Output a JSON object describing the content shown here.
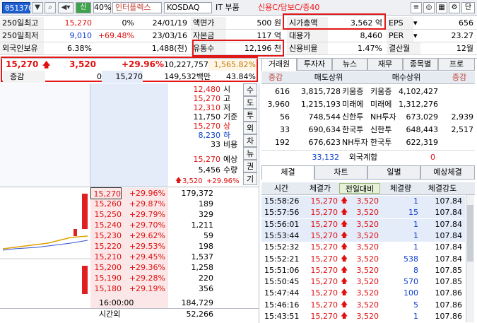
{
  "toolbar": {
    "code": "051370",
    "pct": "40%",
    "name": "인터플렉스",
    "market": "KOSDAQ",
    "sector": "IT 부품",
    "credit": "신용C/담보C/증40",
    "btn_single": "단",
    "btn_sin": "신"
  },
  "info": {
    "high250_label": "250일최고",
    "high250_val": "15,270",
    "high250_pct": "0%",
    "high250_date": "24/01/19",
    "par_label": "액면가",
    "par_val": "500 원",
    "cap_label": "시가총액",
    "cap_val": "3,562 억",
    "eps_label": "EPS",
    "eps_val": "656",
    "low250_label": "250일최저",
    "low250_val": "9,010",
    "low250_pct": "+69.48%",
    "low250_date": "23/03/16",
    "capital_label": "자본금",
    "capital_val": "117 억",
    "lending_label": "대용가",
    "lending_val": "8,460",
    "per_label": "PER",
    "per_val": "23.27",
    "foreign_label": "외국인보유",
    "foreign_pct": "6.38%",
    "foreign_qty": "1,488(천)",
    "float_label": "유통수",
    "float_val": "12,196 천",
    "credit_label": "신용비율",
    "credit_val": "1.47%",
    "settle_label": "결산월",
    "settle_val": "12월"
  },
  "price": {
    "current": "15,270",
    "change": "3,520",
    "change_pct": "+29.96%",
    "volume": "10,227,757",
    "volume_pct": "1,565.82%",
    "row2_label": "증감",
    "row2_a": "0",
    "row2_b": "15,270",
    "row2_c": "149,532백만",
    "row2_d": "43.84%"
  },
  "tabs_top": [
    "거래원",
    "투자자",
    "뉴스",
    "재무",
    "종목별",
    "프로"
  ],
  "broker": {
    "headers": [
      "증감",
      "매도상위",
      "매수상위",
      "증감"
    ],
    "rows": [
      {
        "c1": "616",
        "c2": "3,815,728",
        "c3": "키움증",
        "c4": "키움증",
        "c5": "4,102,427",
        "c6": ""
      },
      {
        "c1": "3,960",
        "c2": "1,215,193",
        "c3": "미래에",
        "c4": "미래에",
        "c5": "1,312,276",
        "c6": ""
      },
      {
        "c1": "56",
        "c2": "748,544",
        "c3": "신한투",
        "c4": "NH투자",
        "c5": "673,029",
        "c6": "2,939"
      },
      {
        "c1": "33",
        "c2": "690,634",
        "c3": "한국투",
        "c4": "신한투",
        "c5": "648,443",
        "c6": "2,517"
      },
      {
        "c1": "192",
        "c2": "676,623",
        "c3": "NH투자",
        "c4": "한국투",
        "c5": "622,319",
        "c6": ""
      }
    ],
    "foreign_sum_left": "33,132",
    "foreign_sum_label": "외국계합",
    "foreign_sum_right": "0"
  },
  "tabs_mid": [
    "체결",
    "차트",
    "일별",
    "예상체결"
  ],
  "trades": {
    "headers": [
      "시간",
      "체결가",
      "전일대비",
      "체결량",
      "체결강도"
    ],
    "rows": [
      {
        "t": "15:58:26",
        "p": "15,270",
        "d": "3,520",
        "q": "1",
        "s": "107.84"
      },
      {
        "t": "15:57:56",
        "p": "15,270",
        "d": "3,520",
        "q": "15",
        "s": "107.84"
      },
      {
        "t": "15:56:01",
        "p": "15,270",
        "d": "3,520",
        "q": "1",
        "s": "107.84"
      },
      {
        "t": "15:53:44",
        "p": "15,270",
        "d": "3,520",
        "q": "1",
        "s": "107.84"
      },
      {
        "t": "15:52:32",
        "p": "15,270",
        "d": "3,520",
        "q": "1",
        "s": "107.84"
      },
      {
        "t": "15:52:21",
        "p": "15,270",
        "d": "3,520",
        "q": "538",
        "s": "107.84"
      },
      {
        "t": "15:51:06",
        "p": "15,270",
        "d": "3,520",
        "q": "8",
        "s": "107.85"
      },
      {
        "t": "15:50:45",
        "p": "15,270",
        "d": "3,520",
        "q": "570",
        "s": "107.85"
      },
      {
        "t": "15:47:44",
        "p": "15,270",
        "d": "3,520",
        "q": "100",
        "s": "107.86"
      },
      {
        "t": "15:46:16",
        "p": "15,270",
        "d": "3,520",
        "q": "5",
        "s": "107.86"
      },
      {
        "t": "15:43:51",
        "p": "15,270",
        "d": "3,520",
        "q": "1",
        "s": "107.86"
      }
    ]
  },
  "summary": {
    "rows": [
      {
        "v": "12,480",
        "l": "시"
      },
      {
        "v": "15,270",
        "l": "고"
      },
      {
        "v": "12,310",
        "l": "저"
      },
      {
        "v": "11,750",
        "l": "기준"
      },
      {
        "v": "15,270",
        "l": "상"
      },
      {
        "v": "8,230",
        "l": "하"
      },
      {
        "v": "33",
        "l": "비용"
      }
    ],
    "expect_price": "15,270",
    "expect_label": "예상",
    "expect_qty": "5,456",
    "expect_qty_label": "수량",
    "expect_change": "3,520",
    "expect_pct": "+29.96%",
    "side_buttons": [
      "수",
      "도",
      "투",
      "외",
      "차",
      "뉴",
      "권",
      "기"
    ]
  },
  "orderbook": {
    "rows": [
      {
        "p": "15,270",
        "pct": "+29.96%",
        "q": "179,372"
      },
      {
        "p": "15,260",
        "pct": "+29.87%",
        "q": "189"
      },
      {
        "p": "15,250",
        "pct": "+29.79%",
        "q": "329"
      },
      {
        "p": "15,240",
        "pct": "+29.70%",
        "q": "1,211"
      },
      {
        "p": "15,230",
        "pct": "+29.62%",
        "q": "59"
      },
      {
        "p": "15,220",
        "pct": "+29.53%",
        "q": "198"
      },
      {
        "p": "15,210",
        "pct": "+29.45%",
        "q": "1,537"
      },
      {
        "p": "15,200",
        "pct": "+29.36%",
        "q": "1,258"
      },
      {
        "p": "15,190",
        "pct": "+29.28%",
        "q": "220"
      },
      {
        "p": "15,180",
        "pct": "+29.19%",
        "q": "356"
      }
    ],
    "bottom_time": "16:00:00",
    "bottom_qty": "184,729",
    "after_label": "시간외",
    "after_qty": "52,266"
  }
}
